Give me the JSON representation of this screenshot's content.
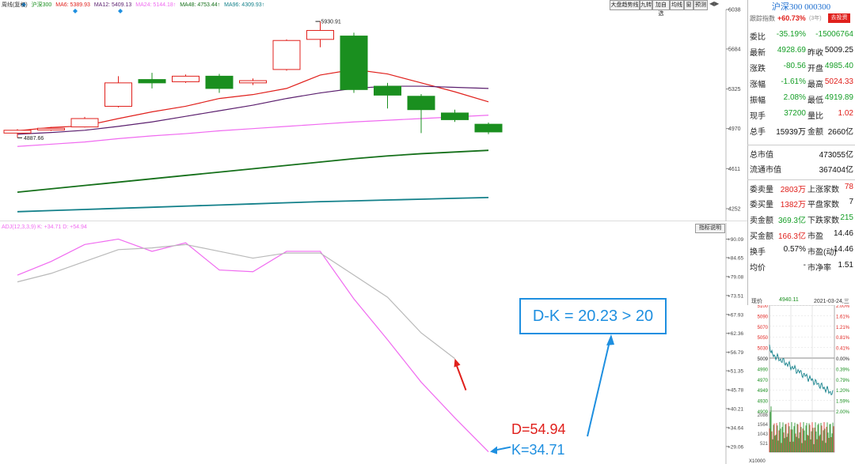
{
  "colors": {
    "up": "#e0201c",
    "down": "#1a8f1f",
    "ma6": "#e0201c",
    "ma12": "#5b1f6e",
    "ma24": "#f06af0",
    "ma48": "#15701a",
    "ma96": "#13808a",
    "k": "#f06af0",
    "d": "#b9b9b9",
    "accent": "#1e8fe0"
  },
  "top": {
    "legend": {
      "prefix": "周线(复权)",
      "index": "沪深300",
      "ma6": "MA6: 5389.93",
      "ma12": "MA12: 5409.13",
      "ma24": "MA24: 5144.18↑",
      "ma48": "MA48: 4753.44↑",
      "ma96": "MA96: 4309.93↑"
    },
    "toolbar": [
      "大盘趋势线",
      "九转",
      "加自选",
      "均线",
      "窗",
      "预测"
    ],
    "annotations": {
      "high": "5930.91",
      "low": "4887.66"
    },
    "yticks": [
      "6038",
      "5684",
      "5325",
      "4970",
      "4611",
      "4252"
    ]
  },
  "bottom": {
    "legend": "ADJ(12,3,3,9) K: +34.71 D: +54.94",
    "button": "指标说明",
    "yticks": [
      "+90.09",
      "+84.65",
      "+79.08",
      "+73.51",
      "+67.93",
      "+62.36",
      "+56.79",
      "+51.35",
      "+45.78",
      "+40.21",
      "+34.64",
      "+29.06"
    ],
    "callout": "D-K = 20.23 > 20",
    "d_label": "D=54.94",
    "k_label": "K=34.71"
  },
  "chart_data": [
    {
      "type": "candlestick",
      "title": "沪深300",
      "period": "weekly",
      "ylim": [
        4252,
        6038
      ],
      "candles": [
        {
          "open": 4930,
          "close": 4955,
          "high": 4965,
          "low": 4887.66
        },
        {
          "open": 4958,
          "close": 4973,
          "high": 4985,
          "low": 4950
        },
        {
          "open": 4985,
          "close": 5060,
          "high": 5075,
          "low": 4980
        },
        {
          "open": 5170,
          "close": 5380,
          "high": 5440,
          "low": 5160
        },
        {
          "open": 5410,
          "close": 5380,
          "high": 5470,
          "low": 5330
        },
        {
          "open": 5390,
          "close": 5440,
          "high": 5455,
          "low": 5380
        },
        {
          "open": 5440,
          "close": 5330,
          "high": 5460,
          "low": 5290
        },
        {
          "open": 5380,
          "close": 5400,
          "high": 5420,
          "low": 5360
        },
        {
          "open": 5500,
          "close": 5760,
          "high": 5770,
          "low": 5490
        },
        {
          "open": 5770,
          "close": 5850,
          "high": 5930.91,
          "low": 5700
        },
        {
          "open": 5800,
          "close": 5320,
          "high": 5830,
          "low": 5290
        },
        {
          "open": 5350,
          "close": 5270,
          "high": 5380,
          "low": 5150
        },
        {
          "open": 5260,
          "close": 5140,
          "high": 5280,
          "low": 4930
        },
        {
          "open": 5110,
          "close": 5050,
          "high": 5140,
          "low": 5030
        },
        {
          "open": 5009.25,
          "close": 4940.11,
          "high": 5024.33,
          "low": 4919.89
        }
      ],
      "series": [
        {
          "name": "MA6",
          "values": [
            4950,
            4980,
            4995,
            5060,
            5120,
            5170,
            5240,
            5275,
            5330,
            5450,
            5500,
            5460,
            5380,
            5300,
            5210
          ]
        },
        {
          "name": "MA12",
          "values": [
            4920,
            4935,
            4955,
            4990,
            5030,
            5080,
            5130,
            5180,
            5240,
            5290,
            5330,
            5350,
            5350,
            5340,
            5330
          ]
        },
        {
          "name": "MA24",
          "values": [
            4810,
            4830,
            4850,
            4880,
            4905,
            4925,
            4950,
            4970,
            4990,
            5010,
            5030,
            5045,
            5060,
            5075,
            5090
          ]
        },
        {
          "name": "MA48",
          "values": [
            4400,
            4430,
            4460,
            4490,
            4520,
            4550,
            4580,
            4610,
            4640,
            4670,
            4700,
            4725,
            4745,
            4760,
            4775
          ]
        },
        {
          "name": "MA96",
          "values": [
            4225,
            4235,
            4245,
            4255,
            4265,
            4275,
            4285,
            4295,
            4305,
            4315,
            4322,
            4330,
            4337,
            4345,
            4352
          ]
        }
      ]
    },
    {
      "type": "line",
      "title": "ADJ(12,3,3,9)",
      "ylim": [
        26,
        93
      ],
      "series": [
        {
          "name": "K",
          "values": [
            79.5,
            83.5,
            88.5,
            90.1,
            86.5,
            89.0,
            81.0,
            80.5,
            86.5,
            86.5,
            72.5,
            60.5,
            48.0,
            37.5,
            27.5
          ]
        },
        {
          "name": "D",
          "values": [
            77.5,
            80.0,
            83.5,
            87.0,
            87.5,
            88.5,
            86.5,
            84.5,
            86.0,
            86.0,
            79.5,
            73.0,
            62.5,
            54.94,
            null
          ]
        }
      ]
    }
  ],
  "right": {
    "header": {
      "title": "沪深300 000300"
    },
    "row1": {
      "l1": "跟踪指数",
      "v1": "+60.73%",
      "n1": "(3年)",
      "btn": "去投资"
    },
    "rows": [
      {
        "l1": "委比",
        "v1": "-35.19%",
        "l2": "",
        "v2": "-15006764",
        "c1": "green",
        "c2": "green"
      },
      {
        "l1": "最新",
        "v1": "4928.69",
        "l2": "昨收",
        "v2": "5009.25",
        "c1": "green",
        "c2": "blk"
      },
      {
        "l1": "涨跌",
        "v1": "-80.56",
        "l2": "开盘",
        "v2": "4985.40",
        "c1": "green",
        "c2": "green"
      },
      {
        "l1": "涨幅",
        "v1": "-1.61%",
        "l2": "最高",
        "v2": "5024.33",
        "c1": "green",
        "c2": "red"
      },
      {
        "l1": "振幅",
        "v1": "2.08%",
        "l2": "最低",
        "v2": "4919.89",
        "c1": "green",
        "c2": "green"
      },
      {
        "l1": "现手",
        "v1": "37200",
        "l2": "量比",
        "v2": "1.02",
        "c1": "green",
        "c2": "red"
      },
      {
        "l1": "总手",
        "v1": "15939万",
        "l2": "金额",
        "v2": "2660亿",
        "c1": "blk",
        "c2": "blk"
      }
    ],
    "rows2": [
      {
        "l1": "总市值",
        "v1": "473055亿"
      },
      {
        "l1": "流通市值",
        "v1": "367404亿"
      }
    ],
    "rows3": [
      {
        "l1": "委卖量",
        "v1": "2803万",
        "l2": "上涨家数",
        "v2": "78",
        "c1": "red",
        "c2": "red"
      },
      {
        "l1": "委买量",
        "v1": "1382万",
        "l2": "平盘家数",
        "v2": "7",
        "c1": "red",
        "c2": "blk"
      },
      {
        "l1": "卖金额",
        "v1": "369.3亿",
        "l2": "下跌家数",
        "v2": "215",
        "c1": "green",
        "c2": "green"
      },
      {
        "l1": "买金额",
        "v1": "166.3亿",
        "l2": "市盈",
        "v2": "14.46",
        "c1": "red",
        "c2": "blk"
      },
      {
        "l1": "换手",
        "v1": "0.57%",
        "l2": "市盈(动)",
        "v2": "14.46",
        "c1": "blk",
        "c2": "blk"
      },
      {
        "l1": "均价",
        "v1": "-",
        "l2": "市净率",
        "v2": "1.51",
        "c1": "blk",
        "c2": "blk"
      }
    ],
    "mini": {
      "label": "现价",
      "price": "4940.11",
      "date": "2021-03-24,三",
      "left_ticks": [
        "5100",
        "5090",
        "5070",
        "5050",
        "5030",
        "5009",
        "4990",
        "4970",
        "4949",
        "4930",
        "4909"
      ],
      "right_ticks": [
        "2.00%",
        "1.61%",
        "1.21%",
        "0.81%",
        "0.41%",
        "0.00%",
        "0.39%",
        "0.79%",
        "1.20%",
        "1.59%",
        "2.00%"
      ],
      "vol_ticks": [
        "2086",
        "1564",
        "1043",
        "521"
      ],
      "vol_label": "X10000"
    }
  }
}
